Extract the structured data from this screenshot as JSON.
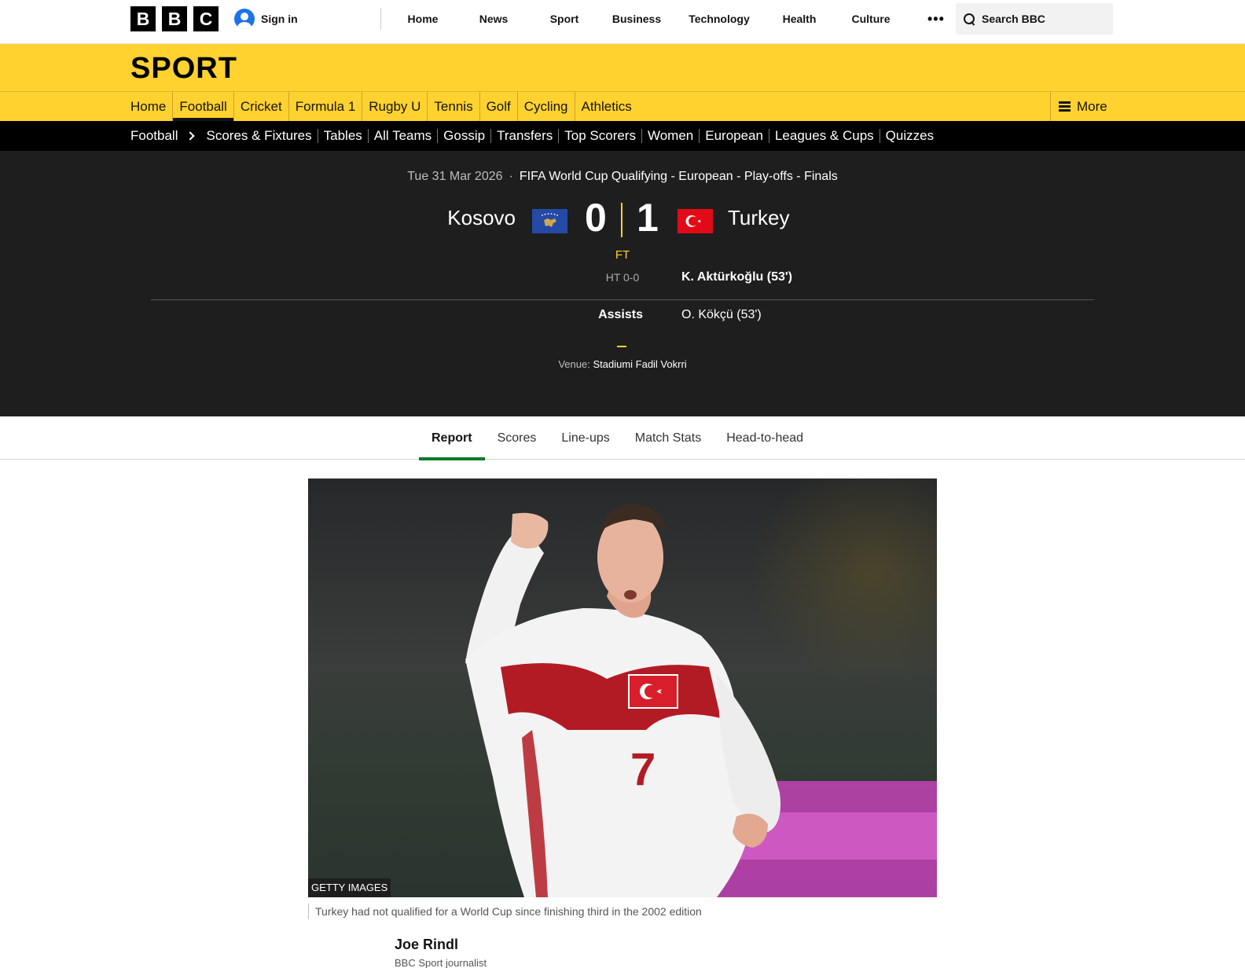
{
  "global_nav": {
    "logo_letters": [
      "B",
      "B",
      "C"
    ],
    "sign_in": "Sign in",
    "items": [
      "Home",
      "News",
      "Sport",
      "Business",
      "Technology",
      "Health",
      "Culture"
    ],
    "more": "•••",
    "search_placeholder": "Search BBC"
  },
  "sport_header": {
    "title": "SPORT",
    "nav": [
      "Home",
      "Football",
      "Cricket",
      "Formula 1",
      "Rugby U",
      "Tennis",
      "Golf",
      "Cycling",
      "Athletics"
    ],
    "active_nav": "Football",
    "more": "More"
  },
  "football_nav": {
    "crumb": "Football",
    "items": [
      "Scores & Fixtures",
      "Tables",
      "All Teams",
      "Gossip",
      "Transfers",
      "Top Scorers",
      "Women",
      "European",
      "Leagues & Cups",
      "Quizzes"
    ]
  },
  "match": {
    "date": "Tue 31 Mar 2026",
    "separator": "·",
    "competition": "FIFA World Cup Qualifying - European - Play-offs - Finals",
    "home_team": "Kosovo",
    "away_team": "Turkey",
    "home_score": "0",
    "away_score": "1",
    "status": "FT",
    "half_time": "HT 0-0",
    "away_scorer": "K. Aktürkoğlu (53')",
    "assists_label": "Assists",
    "away_assist": "O. Kökçü (53')",
    "venue_label": "Venue:",
    "venue": "Stadiumi Fadil Vokrri"
  },
  "tabs": [
    "Report",
    "Scores",
    "Line-ups",
    "Match Stats",
    "Head-to-head"
  ],
  "active_tab": "Report",
  "article": {
    "image_credit": "GETTY IMAGES",
    "caption": "Turkey had not qualified for a World Cup since finishing third in the 2002 edition",
    "author": "Joe Rindl",
    "author_role": "BBC Sport journalist",
    "shirt_number": "7"
  },
  "colors": {
    "sport_yellow": "#ffd230",
    "match_bg": "#1e1e1e",
    "tab_active": "#0b7a27",
    "kosovo_blue": "#244aa5",
    "turkey_red": "#e30a17"
  }
}
